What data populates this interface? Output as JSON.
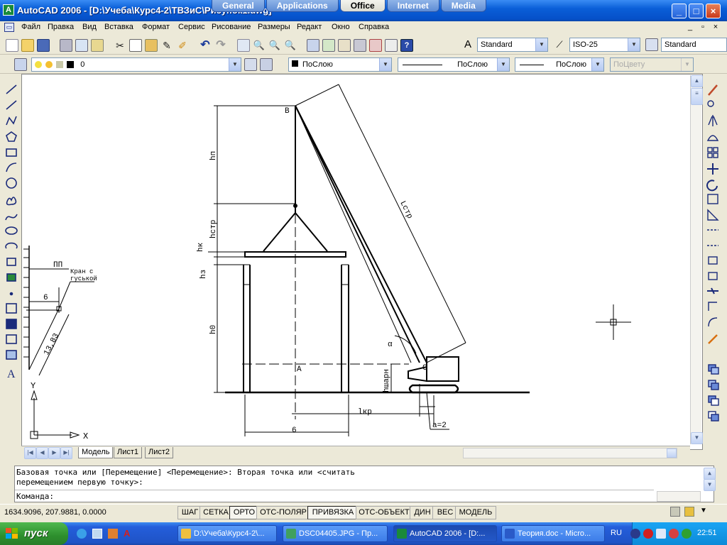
{
  "window": {
    "title": "AutoCAD 2006 - [D:\\Учеба\\Курс4-2\\ТВЗиС\\Рисунок1.dwg]",
    "ribbon_tabs": [
      "General",
      "Applications",
      "Office",
      "Internet",
      "Media"
    ],
    "active_ribbon_tab": "Office",
    "buttons": {
      "minimize": "_",
      "maximize": "□",
      "close": "×"
    }
  },
  "menubar": {
    "items": [
      "Файл",
      "Правка",
      "Вид",
      "Вставка",
      "Формат",
      "Сервис",
      "Рисование",
      "Размеры",
      "Редакт",
      "Окно",
      "Справка"
    ],
    "mdi_buttons": [
      "_",
      "▫",
      "×"
    ]
  },
  "toolbar_standard": {
    "text_style": "Standard",
    "dim_style": "ISO-25",
    "table_style": "Standard"
  },
  "toolbar_layers": {
    "layer_name": "0",
    "color": "ПоСлою",
    "linetype": "ПоСлою",
    "lineweight": "ПоСлою",
    "plot_style": "ПоЦвету"
  },
  "drawing": {
    "labels": {
      "B": "B",
      "A": "A",
      "C": "C",
      "alpha": "α",
      "hp": "hп",
      "hstr": "hстр",
      "hk": "hк",
      "hz": "hз",
      "h0": "h0",
      "hsharn": "hшарн",
      "lstr": "Lстр",
      "lkr": "lкр",
      "six_bottom": "6",
      "a2": "a=2",
      "pp": "ПП",
      "kran1": "Кран с",
      "kran2": "гуськой",
      "six_left": "6",
      "num": "13,83",
      "y_axis": "Y",
      "x_axis": "X"
    }
  },
  "layout_tabs": {
    "nav": [
      "|◀",
      "◀",
      "▶",
      "▶|"
    ],
    "tabs": [
      "Модель",
      "Лист1",
      "Лист2"
    ],
    "active": "Модель"
  },
  "command": {
    "line1": "Базовая точка или [Перемещение] <Перемещение>: Вторая точка или <считать",
    "line2": "перемещением первую точку>:",
    "prompt": "Команда:"
  },
  "statusbar": {
    "coords": "1634.9096, 207.9881, 0.0000",
    "toggles": [
      {
        "label": "ШАГ",
        "on": false
      },
      {
        "label": "СЕТКА",
        "on": false
      },
      {
        "label": "ОРТО",
        "on": true
      },
      {
        "label": "ОТС-ПОЛЯР",
        "on": false
      },
      {
        "label": "ПРИВЯЗКА",
        "on": true
      },
      {
        "label": "ОТС-ОБЪЕКТ",
        "on": false
      },
      {
        "label": "ДИН",
        "on": false
      },
      {
        "label": "ВЕС",
        "on": false
      },
      {
        "label": "МОДЕЛЬ",
        "on": false
      }
    ]
  },
  "taskbar": {
    "start": "пуск",
    "tasks": [
      {
        "label": "D:\\Учеба\\Курс4-2\\...",
        "color": "#f0c040"
      },
      {
        "label": "DSC04405.JPG - Пр...",
        "color": "#40a060"
      },
      {
        "label": "AutoCAD 2006 - [D:...",
        "color": "#1a8a3a"
      },
      {
        "label": "Теория.doc - Micro...",
        "color": "#2a5ac8"
      }
    ],
    "active_task": 2,
    "lang": "RU",
    "clock": "22:51"
  }
}
